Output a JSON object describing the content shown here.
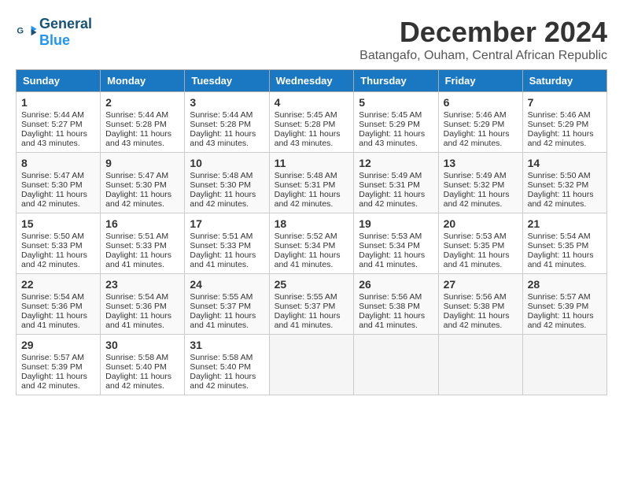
{
  "logo": {
    "general": "General",
    "blue": "Blue"
  },
  "title": "December 2024",
  "subtitle": "Batangafo, Ouham, Central African Republic",
  "weekdays": [
    "Sunday",
    "Monday",
    "Tuesday",
    "Wednesday",
    "Thursday",
    "Friday",
    "Saturday"
  ],
  "weeks": [
    [
      {
        "day": "1",
        "lines": [
          "Sunrise: 5:44 AM",
          "Sunset: 5:27 PM",
          "Daylight: 11 hours",
          "and 43 minutes."
        ]
      },
      {
        "day": "2",
        "lines": [
          "Sunrise: 5:44 AM",
          "Sunset: 5:28 PM",
          "Daylight: 11 hours",
          "and 43 minutes."
        ]
      },
      {
        "day": "3",
        "lines": [
          "Sunrise: 5:44 AM",
          "Sunset: 5:28 PM",
          "Daylight: 11 hours",
          "and 43 minutes."
        ]
      },
      {
        "day": "4",
        "lines": [
          "Sunrise: 5:45 AM",
          "Sunset: 5:28 PM",
          "Daylight: 11 hours",
          "and 43 minutes."
        ]
      },
      {
        "day": "5",
        "lines": [
          "Sunrise: 5:45 AM",
          "Sunset: 5:29 PM",
          "Daylight: 11 hours",
          "and 43 minutes."
        ]
      },
      {
        "day": "6",
        "lines": [
          "Sunrise: 5:46 AM",
          "Sunset: 5:29 PM",
          "Daylight: 11 hours",
          "and 42 minutes."
        ]
      },
      {
        "day": "7",
        "lines": [
          "Sunrise: 5:46 AM",
          "Sunset: 5:29 PM",
          "Daylight: 11 hours",
          "and 42 minutes."
        ]
      }
    ],
    [
      {
        "day": "8",
        "lines": [
          "Sunrise: 5:47 AM",
          "Sunset: 5:30 PM",
          "Daylight: 11 hours",
          "and 42 minutes."
        ]
      },
      {
        "day": "9",
        "lines": [
          "Sunrise: 5:47 AM",
          "Sunset: 5:30 PM",
          "Daylight: 11 hours",
          "and 42 minutes."
        ]
      },
      {
        "day": "10",
        "lines": [
          "Sunrise: 5:48 AM",
          "Sunset: 5:30 PM",
          "Daylight: 11 hours",
          "and 42 minutes."
        ]
      },
      {
        "day": "11",
        "lines": [
          "Sunrise: 5:48 AM",
          "Sunset: 5:31 PM",
          "Daylight: 11 hours",
          "and 42 minutes."
        ]
      },
      {
        "day": "12",
        "lines": [
          "Sunrise: 5:49 AM",
          "Sunset: 5:31 PM",
          "Daylight: 11 hours",
          "and 42 minutes."
        ]
      },
      {
        "day": "13",
        "lines": [
          "Sunrise: 5:49 AM",
          "Sunset: 5:32 PM",
          "Daylight: 11 hours",
          "and 42 minutes."
        ]
      },
      {
        "day": "14",
        "lines": [
          "Sunrise: 5:50 AM",
          "Sunset: 5:32 PM",
          "Daylight: 11 hours",
          "and 42 minutes."
        ]
      }
    ],
    [
      {
        "day": "15",
        "lines": [
          "Sunrise: 5:50 AM",
          "Sunset: 5:33 PM",
          "Daylight: 11 hours",
          "and 42 minutes."
        ]
      },
      {
        "day": "16",
        "lines": [
          "Sunrise: 5:51 AM",
          "Sunset: 5:33 PM",
          "Daylight: 11 hours",
          "and 41 minutes."
        ]
      },
      {
        "day": "17",
        "lines": [
          "Sunrise: 5:51 AM",
          "Sunset: 5:33 PM",
          "Daylight: 11 hours",
          "and 41 minutes."
        ]
      },
      {
        "day": "18",
        "lines": [
          "Sunrise: 5:52 AM",
          "Sunset: 5:34 PM",
          "Daylight: 11 hours",
          "and 41 minutes."
        ]
      },
      {
        "day": "19",
        "lines": [
          "Sunrise: 5:53 AM",
          "Sunset: 5:34 PM",
          "Daylight: 11 hours",
          "and 41 minutes."
        ]
      },
      {
        "day": "20",
        "lines": [
          "Sunrise: 5:53 AM",
          "Sunset: 5:35 PM",
          "Daylight: 11 hours",
          "and 41 minutes."
        ]
      },
      {
        "day": "21",
        "lines": [
          "Sunrise: 5:54 AM",
          "Sunset: 5:35 PM",
          "Daylight: 11 hours",
          "and 41 minutes."
        ]
      }
    ],
    [
      {
        "day": "22",
        "lines": [
          "Sunrise: 5:54 AM",
          "Sunset: 5:36 PM",
          "Daylight: 11 hours",
          "and 41 minutes."
        ]
      },
      {
        "day": "23",
        "lines": [
          "Sunrise: 5:54 AM",
          "Sunset: 5:36 PM",
          "Daylight: 11 hours",
          "and 41 minutes."
        ]
      },
      {
        "day": "24",
        "lines": [
          "Sunrise: 5:55 AM",
          "Sunset: 5:37 PM",
          "Daylight: 11 hours",
          "and 41 minutes."
        ]
      },
      {
        "day": "25",
        "lines": [
          "Sunrise: 5:55 AM",
          "Sunset: 5:37 PM",
          "Daylight: 11 hours",
          "and 41 minutes."
        ]
      },
      {
        "day": "26",
        "lines": [
          "Sunrise: 5:56 AM",
          "Sunset: 5:38 PM",
          "Daylight: 11 hours",
          "and 41 minutes."
        ]
      },
      {
        "day": "27",
        "lines": [
          "Sunrise: 5:56 AM",
          "Sunset: 5:38 PM",
          "Daylight: 11 hours",
          "and 42 minutes."
        ]
      },
      {
        "day": "28",
        "lines": [
          "Sunrise: 5:57 AM",
          "Sunset: 5:39 PM",
          "Daylight: 11 hours",
          "and 42 minutes."
        ]
      }
    ],
    [
      {
        "day": "29",
        "lines": [
          "Sunrise: 5:57 AM",
          "Sunset: 5:39 PM",
          "Daylight: 11 hours",
          "and 42 minutes."
        ]
      },
      {
        "day": "30",
        "lines": [
          "Sunrise: 5:58 AM",
          "Sunset: 5:40 PM",
          "Daylight: 11 hours",
          "and 42 minutes."
        ]
      },
      {
        "day": "31",
        "lines": [
          "Sunrise: 5:58 AM",
          "Sunset: 5:40 PM",
          "Daylight: 11 hours",
          "and 42 minutes."
        ]
      },
      null,
      null,
      null,
      null
    ]
  ]
}
